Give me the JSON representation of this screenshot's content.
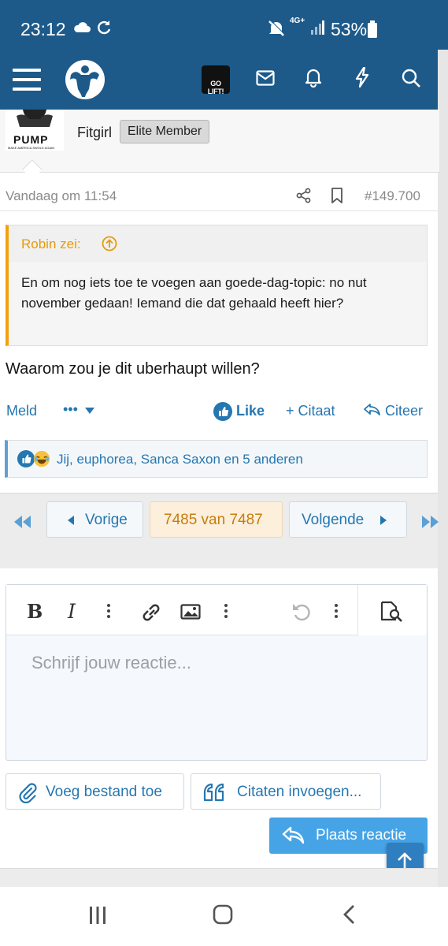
{
  "status_bar": {
    "time": "23:12",
    "network": "4G+",
    "battery": "53%",
    "icons": [
      "cloud-icon",
      "sync-icon",
      "mute-icon",
      "signal-icon",
      "battery-icon"
    ]
  },
  "header": {
    "icons": [
      "menu-icon",
      "forum-logo",
      "go-lift-logo",
      "inbox-icon",
      "bell-icon",
      "lightning-icon",
      "search-icon"
    ],
    "go_lift_label": "GO LIFT!"
  },
  "post": {
    "avatar_text": "PUMP",
    "avatar_slogan": "MAKE AMERICA SWOLE AGAIN",
    "username": "Fitgirl",
    "badge": "Elite Member",
    "date": "Vandaag om 11:54",
    "post_number": "#149.700",
    "quote": {
      "author": "Robin zei:",
      "body": "En om nog iets toe te voegen aan goede-dag-topic: no nut november gedaan! Iemand die dat gehaald heeft hier?"
    },
    "text": "Waarom zou je dit uberhaupt willen?",
    "actions": {
      "report": "Meld",
      "more": "•••",
      "like": "Like",
      "quote": "+ Citaat",
      "reply": "Citeer"
    },
    "reactions": "Jij, euphorea, Sanca Saxon en 5 anderen"
  },
  "pagination": {
    "prev": "Vorige",
    "current": "7485 van 7487",
    "next": "Volgende"
  },
  "editor": {
    "placeholder": "Schrijf jouw reactie...",
    "bold": "B",
    "italic": "I",
    "attach_label": "Voeg bestand toe",
    "insert_quotes_label": "Citaten invoegen...",
    "post_label": "Plaats reactie"
  },
  "colors": {
    "brand": "#1d5a8a",
    "link": "#2577b1",
    "quote_accent": "#f3a10d",
    "primary_button": "#46a4e6"
  }
}
